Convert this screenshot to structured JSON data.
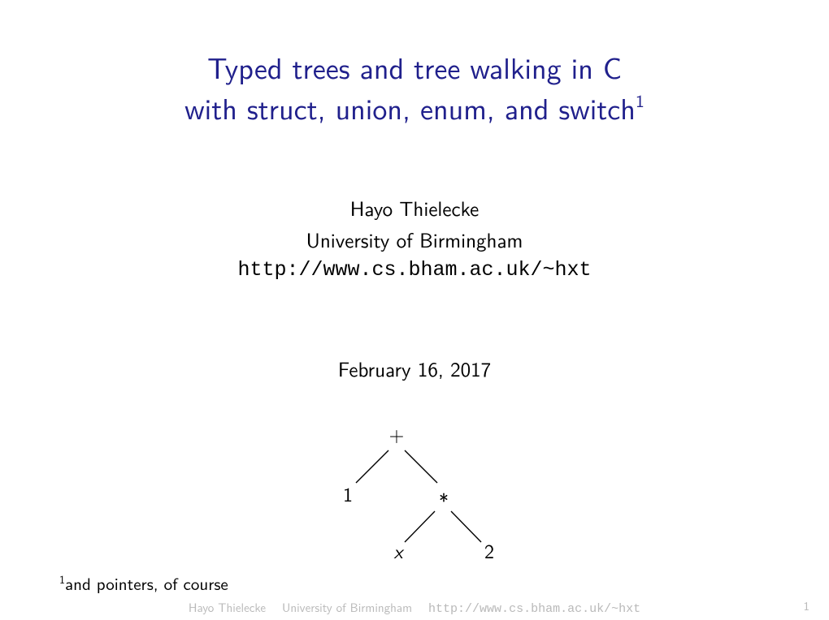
{
  "title": {
    "line1": "Typed trees and tree walking in C",
    "line2_pre": "with struct, union, enum, and switch",
    "line2_sup": "1"
  },
  "author": {
    "name": "Hayo Thielecke",
    "affiliation": "University of Birmingham",
    "url": "http://www.cs.bham.ac.uk/~hxt"
  },
  "date": "February 16, 2017",
  "tree": {
    "root": "+",
    "left": "1",
    "right": "∗",
    "right_left": "x",
    "right_right": "2"
  },
  "footnote": {
    "marker": "1",
    "text": "and pointers, of course"
  },
  "footer": {
    "author": "Hayo Thielecke",
    "affiliation": "University of Birmingham",
    "url": "http://www.cs.bham.ac.uk/~hxt",
    "page": "1"
  }
}
